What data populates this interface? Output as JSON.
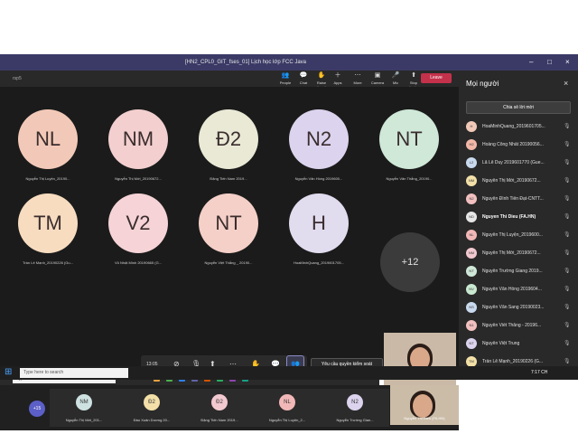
{
  "window": {
    "title": "[HN2_CPL0_GIT_fses_01] Lịch học lớp FCC Java",
    "controls": [
      "–",
      "□",
      "×"
    ]
  },
  "meeting": {
    "timer": "rsp5",
    "toolbar": [
      {
        "label": "People",
        "icon": "people-icon",
        "glyph": "👥"
      },
      {
        "label": "Chat",
        "icon": "chat-icon",
        "glyph": "💬"
      },
      {
        "label": "Raise hand",
        "icon": "hand-icon",
        "glyph": "✋"
      },
      {
        "label": "Apps",
        "icon": "apps-icon",
        "glyph": "＋"
      },
      {
        "label": "More",
        "icon": "more-icon",
        "glyph": "⋯"
      },
      {
        "label": "Camera",
        "icon": "camera-icon",
        "glyph": "▣"
      },
      {
        "label": "Mic",
        "icon": "mic-icon",
        "glyph": "🎤"
      },
      {
        "label": "Stop sharing",
        "icon": "share-icon",
        "glyph": "⬆"
      }
    ],
    "leave_label": "Leave",
    "tiles": [
      {
        "initials": "NL",
        "name": "Nguyễn Thị Luyện_20190...",
        "color": "#f2c9b8"
      },
      {
        "initials": "NM",
        "name": "Nguyễn Thị Mới_20190672...",
        "color": "#f3cfcf"
      },
      {
        "initials": "Đ2",
        "name": "Đặng Tiến Nam 2019...",
        "color": "#e9e9d6"
      },
      {
        "initials": "N2",
        "name": "Nguyễn Văn Hồng 2019600...",
        "color": "#dcd3ee"
      },
      {
        "initials": "NT",
        "name": "Nguyễn Văn Thắng_20190...",
        "color": "#cfe8d8"
      },
      {
        "initials": "TM",
        "name": "Trần Lê Mạnh_20190226 (Gu...",
        "color": "#f7dcc0"
      },
      {
        "initials": "V2",
        "name": "Vũ Nhật Minh 20190665 (G...",
        "color": "#f5d3d6"
      },
      {
        "initials": "NT",
        "name": "Nguyễn Việt Thắng _ 20190...",
        "color": "#f5d0c8"
      },
      {
        "initials": "H",
        "name": "HoaMinhQuang_2019601705...",
        "color": "#e2dcef"
      }
    ],
    "more_count": "+12",
    "controls_time": "13:05",
    "request_control": "Yêu cầu quyền kiểm soát"
  },
  "people": {
    "title": "Mọi người",
    "share_invite": "Chia sẻ lời mời",
    "list": [
      {
        "initials": "H",
        "name": "HoaMinhQuang_2019601705...",
        "color": "#f2c9b8"
      },
      {
        "initials": "H2",
        "name": "Hoàng Công Nhất 20190056...",
        "color": "#f3b8a8"
      },
      {
        "initials": "L2",
        "name": "Lã Lê Duy 2019601770 (Gue...",
        "color": "#c9d9ee"
      },
      {
        "initials": "NM",
        "name": "Nguyễn Thị Mới_20190672...",
        "color": "#f3e0a8"
      },
      {
        "initials": "N2",
        "name": "Nguyễn Đình Tiến Đạt-CNTT...",
        "color": "#f3c0c0"
      },
      {
        "initials": "ND",
        "name": "Nguyen Thi Dieu (FA.HN)",
        "color": "#e6e6e6",
        "bold": true
      },
      {
        "initials": "NL",
        "name": "Nguyễn Thị Luyện_2019600...",
        "color": "#f2b8b8"
      },
      {
        "initials": "NM",
        "name": "Nguyễn Thị Mới_20190672...",
        "color": "#f3c9d0"
      },
      {
        "initials": "NT",
        "name": "Nguyễn Trường Giang 2019...",
        "color": "#cfe8d8"
      },
      {
        "initials": "NV",
        "name": "Nguyễn Văn Hồng 2019604...",
        "color": "#c9e9d0"
      },
      {
        "initials": "NS",
        "name": "Nguyễn Văn Sang 20190023...",
        "color": "#c9d9ee"
      },
      {
        "initials": "N1",
        "name": "Nguyễn Viết Thắng - 20196...",
        "color": "#f3c0c0"
      },
      {
        "initials": "NT",
        "name": "Nguyễn Việt Trung",
        "color": "#dcd3ee"
      },
      {
        "initials": "TM",
        "name": "Trần Lê Mạnh_20190226 (G...",
        "color": "#f3e0a8"
      }
    ]
  },
  "row2": {
    "count": "+15",
    "tiles": [
      {
        "initials": "NM",
        "name": "Nguyễn Thị Mới_201...",
        "color": "#cfe2e2"
      },
      {
        "initials": "Đ2",
        "name": "Đào Xuân Dương 20...",
        "color": "#f3e0a8"
      },
      {
        "initials": "Đ2",
        "name": "Đặng Tiến Nam 2019...",
        "color": "#f3c9d0"
      },
      {
        "initials": "NL",
        "name": "Nguyễn Thị Luyện_2...",
        "color": "#f2b8b8"
      },
      {
        "initials": "N2",
        "name": "Nguyễn Trường Gian...",
        "color": "#dcd3ee"
      }
    ],
    "self_name": "Nguyễn Thị Dieu (FA.HN)"
  },
  "taskbar": {
    "search": "Type here to search",
    "time": "7:17 CH",
    "inner_search": "Type here to search",
    "inner_time": "7:17 PM"
  }
}
